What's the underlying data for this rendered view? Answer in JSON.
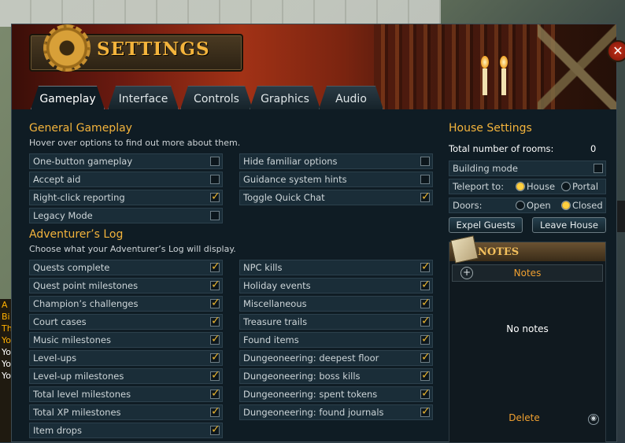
{
  "window": {
    "title": "SETTINGS"
  },
  "tabs": [
    {
      "label": "Gameplay",
      "active": true
    },
    {
      "label": "Interface",
      "active": false
    },
    {
      "label": "Controls",
      "active": false
    },
    {
      "label": "Graphics",
      "active": false
    },
    {
      "label": "Audio",
      "active": false
    }
  ],
  "general": {
    "heading": "General Gameplay",
    "hint": "Hover over options to find out more about them.",
    "left": [
      {
        "label": "One-button gameplay",
        "checked": false
      },
      {
        "label": "Accept aid",
        "checked": false
      },
      {
        "label": "Right-click reporting",
        "checked": true
      },
      {
        "label": "Legacy Mode",
        "checked": false
      }
    ],
    "right": [
      {
        "label": "Hide familiar options",
        "checked": false
      },
      {
        "label": "Guidance system hints",
        "checked": false
      },
      {
        "label": "Toggle Quick Chat",
        "checked": true
      }
    ]
  },
  "adventurers_log": {
    "heading": "Adventurer’s Log",
    "hint": "Choose what your Adventurer’s Log will display.",
    "left": [
      {
        "label": "Quests complete",
        "checked": true
      },
      {
        "label": "Quest point milestones",
        "checked": true
      },
      {
        "label": "Champion’s challenges",
        "checked": true
      },
      {
        "label": "Court cases",
        "checked": true
      },
      {
        "label": "Music milestones",
        "checked": true
      },
      {
        "label": "Level-ups",
        "checked": true
      },
      {
        "label": "Level-up milestones",
        "checked": true
      },
      {
        "label": "Total level milestones",
        "checked": true
      },
      {
        "label": "Total XP milestones",
        "checked": true
      },
      {
        "label": "Item drops",
        "checked": true
      }
    ],
    "right": [
      {
        "label": "NPC kills",
        "checked": true
      },
      {
        "label": "Holiday events",
        "checked": true
      },
      {
        "label": "Miscellaneous",
        "checked": true
      },
      {
        "label": "Treasure trails",
        "checked": true
      },
      {
        "label": "Found items",
        "checked": true
      },
      {
        "label": "Dungeoneering: deepest floor",
        "checked": true
      },
      {
        "label": "Dungeoneering: boss kills",
        "checked": true
      },
      {
        "label": "Dungeoneering: spent tokens",
        "checked": true
      },
      {
        "label": "Dungeoneering: found journals",
        "checked": true
      }
    ]
  },
  "house": {
    "heading": "House Settings",
    "rooms_label": "Total  number of rooms:",
    "rooms_value": "0",
    "building_mode_label": "Building mode",
    "building_mode": false,
    "teleport_label": "Teleport to:",
    "teleport_options": [
      "House",
      "Portal"
    ],
    "teleport_selected": "House",
    "doors_label": "Doors:",
    "doors_options": [
      "Open",
      "Closed"
    ],
    "doors_selected": "Closed",
    "expel_label": "Expel Guests",
    "leave_label": "Leave House"
  },
  "notes": {
    "title": "NOTES",
    "add_label": "Notes",
    "empty_text": "No notes",
    "delete_label": "Delete"
  },
  "background": {
    "chat_fragments": [
      "A",
      "Bi",
      "Th",
      "Yo",
      "Yo",
      "Yo",
      "Yo"
    ]
  },
  "colors": {
    "accent": "#f4b43c",
    "panel": "#1a2d38",
    "check": "#e8b430"
  }
}
